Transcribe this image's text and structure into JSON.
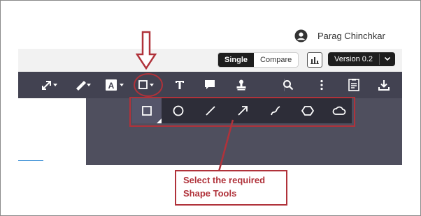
{
  "user": {
    "name": "Parag Chinchkar",
    "avatar_icon": "user-circle-icon"
  },
  "view_toggle": {
    "single": "Single",
    "compare": "Compare",
    "selected": "Single"
  },
  "version": {
    "label": "Version 0.2"
  },
  "toolbar": {
    "icons": [
      "arrow-tool-icon",
      "highlighter-icon",
      "text-box-icon",
      "shape-tool-icon",
      "text-tool-icon",
      "comment-icon",
      "stamp-icon",
      "search-icon",
      "more-icon",
      "summary-icon",
      "download-icon"
    ]
  },
  "shape_flyout": {
    "tools": [
      "rectangle",
      "ellipse",
      "line",
      "arrow",
      "freehand",
      "polygon",
      "cloud"
    ],
    "selected": "rectangle"
  },
  "annotation": {
    "line1": "Select the required",
    "line2": "Shape Tools",
    "accent_color": "#b0323a"
  },
  "colors": {
    "toolbar": "#424251",
    "flyout": "#2d2d38",
    "canvas": "#4f4f5e"
  }
}
